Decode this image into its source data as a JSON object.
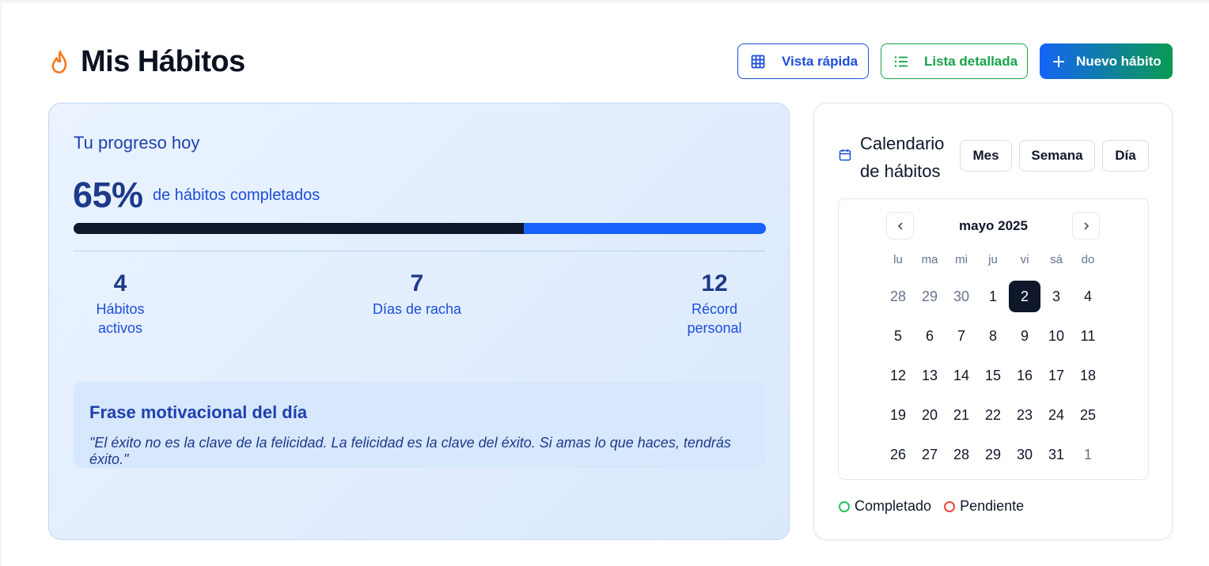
{
  "header": {
    "title": "Mis Hábitos",
    "quick_view_label": "Vista rápida",
    "list_view_label": "Lista detallada",
    "new_habit_label": "Nuevo hábito"
  },
  "progress": {
    "title": "Tu progreso hoy",
    "percent_text": "65%",
    "percent_value": 65,
    "percent_label": "de hábitos completados",
    "stats": [
      {
        "value": "4",
        "label": "Hábitos activos"
      },
      {
        "value": "7",
        "label": "Días de racha"
      },
      {
        "value": "12",
        "label": "Récord personal"
      }
    ],
    "quote": {
      "title": "Frase motivacional del día",
      "text": "\"El éxito no es la clave de la felicidad. La felicidad es la clave del éxito. Si amas lo que haces, tendrás éxito.\""
    }
  },
  "calendar": {
    "title": "Calendario de hábitos",
    "views": [
      "Mes",
      "Semana",
      "Día"
    ],
    "month_label": "mayo 2025",
    "weekdays": [
      "lu",
      "ma",
      "mi",
      "ju",
      "vi",
      "sá",
      "do"
    ],
    "days": [
      {
        "d": "28",
        "out": true
      },
      {
        "d": "29",
        "out": true
      },
      {
        "d": "30",
        "out": true
      },
      {
        "d": "1"
      },
      {
        "d": "2",
        "selected": true
      },
      {
        "d": "3"
      },
      {
        "d": "4"
      },
      {
        "d": "5"
      },
      {
        "d": "6"
      },
      {
        "d": "7"
      },
      {
        "d": "8"
      },
      {
        "d": "9"
      },
      {
        "d": "10"
      },
      {
        "d": "11"
      },
      {
        "d": "12"
      },
      {
        "d": "13"
      },
      {
        "d": "14"
      },
      {
        "d": "15"
      },
      {
        "d": "16"
      },
      {
        "d": "17"
      },
      {
        "d": "18"
      },
      {
        "d": "19"
      },
      {
        "d": "20"
      },
      {
        "d": "21"
      },
      {
        "d": "22"
      },
      {
        "d": "23"
      },
      {
        "d": "24"
      },
      {
        "d": "25"
      },
      {
        "d": "26"
      },
      {
        "d": "27"
      },
      {
        "d": "28"
      },
      {
        "d": "29"
      },
      {
        "d": "30"
      },
      {
        "d": "31"
      },
      {
        "d": "1",
        "out": true
      }
    ],
    "legend": [
      {
        "label": "Completado",
        "color": "#22c55e"
      },
      {
        "label": "Pendiente",
        "color": "#ef4444"
      }
    ]
  }
}
